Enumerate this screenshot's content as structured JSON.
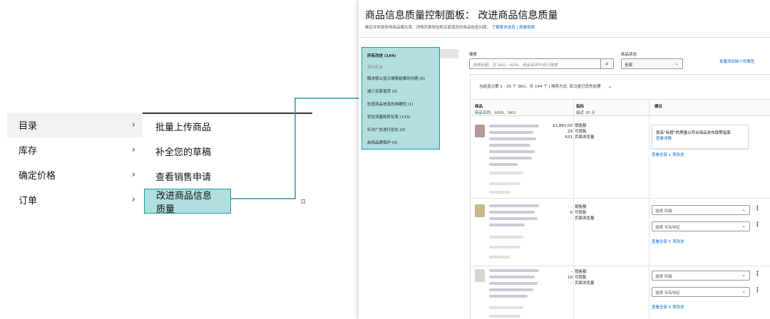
{
  "menu": {
    "main_items": [
      {
        "label": "目录",
        "chev": "›"
      },
      {
        "label": "库存",
        "chev": "›"
      },
      {
        "label": "确定价格",
        "chev": "›"
      },
      {
        "label": "订单",
        "chev": "›"
      }
    ],
    "sub_items": [
      {
        "label": "批量上传商品"
      },
      {
        "label": "补全您的草稿"
      },
      {
        "label": "查看销售申请"
      },
      {
        "label": "改进商品信息质量"
      }
    ],
    "bookmark_icon": "⌑"
  },
  "panel": {
    "title": "商品信息质量控制面板： 改进商品信息质量",
    "description": "确定并修复影响商品曝光率、详情页面体验和买家退货的商品信息问题。",
    "learn_more": "了解更多信息",
    "separator": "|",
    "watch_video": "观看视频",
    "filters": {
      "all_issues": "所有改进 (144)",
      "section_label": "增长机会",
      "items": [
        "解决禁止显示搜索结果的问题 (0)",
        "减少买家退货 (0)",
        "检查商品信息的准确性 (1)",
        "优化流量和转化率 (143)",
        "针对广告进行优化 (0)",
        "启用品牌保护 (0)"
      ]
    },
    "search": {
      "label": "搜索",
      "placeholder": "搜索标题、在 SKU、ASIN、商品名称中进行搜索",
      "button_icon": "⌕"
    },
    "status": {
      "label": "商品状态",
      "value": "全部",
      "chev": "⌄"
    },
    "batch_link": "批量添加缺少的属性",
    "summary": {
      "text": "当前显示第 1 - 25 个 SKU，共 144 个  |  排序方式:  亚马逊已优先处理",
      "chev": "⌄"
    },
    "columns": {
      "product": "商品",
      "product_sub": "商品名称、ASIN、SKU",
      "metrics": "指标",
      "metrics_sub": "最近 30 天",
      "suggestion": "建议"
    },
    "rows": [
      {
        "metric_labels": [
          "销售额",
          "可销售",
          "页面浏览量"
        ],
        "metric_values": [
          "$1,991.00",
          "29",
          "631"
        ],
        "suggest_title": "提高“标题”的质量以符合商品发布政策指南",
        "suggest_link": "查看详情",
        "view_all": "查看全部 1 项改进"
      },
      {
        "metric_labels": [
          "销售额",
          "可销售",
          "页面浏览量"
        ],
        "metric_values": [
          "-",
          "0",
          "-"
        ],
        "select1": "选择 风格",
        "select2": "选择 专有特征",
        "chev": "⌄",
        "more_icon": "⋮",
        "view_all": "查看全部 5 项改进"
      },
      {
        "metric_labels": [
          "销售额",
          "可销售",
          "页面浏览量"
        ],
        "metric_values": [
          "-",
          "10",
          "-"
        ],
        "select1": "选择 风格",
        "select2": "选择 专有特征",
        "chev": "⌄",
        "more_icon": "⋮",
        "view_all": "查看全部 5 项改进"
      }
    ]
  }
}
